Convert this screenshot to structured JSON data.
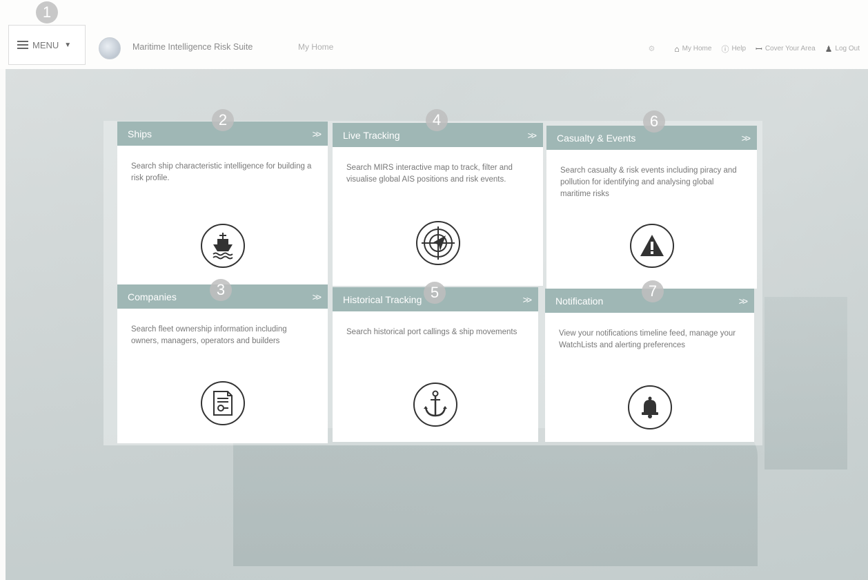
{
  "header": {
    "menu_label": "MENU",
    "app_title": "Maritime Intelligence Risk Suite",
    "breadcrumb": "My Home",
    "links": {
      "my_home": "My Home",
      "help": "Help",
      "cover_your_area": "Cover Your Area",
      "log_out": "Log Out"
    }
  },
  "badges": [
    "1",
    "2",
    "3",
    "4",
    "5",
    "6",
    "7"
  ],
  "tiles": {
    "ships": {
      "title": "Ships",
      "description": "Search ship characteristic intelligence for building a risk profile.",
      "icon": "ship-icon"
    },
    "live_tracking": {
      "title": "Live Tracking",
      "description": "Search MIRS interactive map to track, filter and visualise global AIS positions and risk events.",
      "icon": "radar-icon"
    },
    "casualty": {
      "title": "Casualty & Events",
      "description": "Search casualty & risk events including piracy and pollution for identifying and analysing global maritime risks",
      "icon": "warning-icon"
    },
    "companies": {
      "title": "Companies",
      "description": "Search fleet ownership information including owners, managers, operators and builders",
      "icon": "certificate-icon"
    },
    "historical": {
      "title": "Historical Tracking",
      "description": "Search historical port callings & ship movements",
      "icon": "anchor-icon"
    },
    "notification": {
      "title": "Notification",
      "description": "View your notifications timeline feed, manage your WatchLists and alerting preferences",
      "icon": "bell-icon"
    }
  },
  "colors": {
    "tile_header": "#9fb7b5",
    "badge": "#bebebe",
    "icon_stroke": "#333333"
  }
}
